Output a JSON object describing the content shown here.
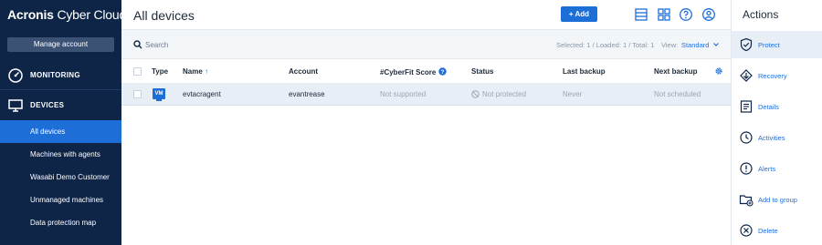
{
  "app": {
    "brand": "Acronis",
    "product": "Cyber Cloud",
    "accent_color": "#1e6ed8",
    "sidebar_color": "#0e2547"
  },
  "sidebar": {
    "manage_account_label": "Manage account",
    "monitoring_label": "MONITORING",
    "devices_label": "DEVICES",
    "sub_items": [
      {
        "label": "All devices",
        "active": true
      },
      {
        "label": "Machines with agents",
        "active": false
      },
      {
        "label": "Wasabi Demo Customer",
        "active": false
      },
      {
        "label": "Unmanaged machines",
        "active": false
      },
      {
        "label": "Data protection map",
        "active": false
      }
    ]
  },
  "header": {
    "title": "All devices",
    "add_label": "+ Add",
    "icons": [
      "columns-icon",
      "grid-icon",
      "help-icon",
      "user-icon"
    ]
  },
  "toolbar": {
    "search_placeholder": "Search",
    "counts_text": "Selected: 1 / Loaded: 1 / Total: 1",
    "view_label": "View:",
    "view_value": "Standard"
  },
  "table": {
    "columns": {
      "type": "Type",
      "name": "Name",
      "account": "Account",
      "cyberfit": "#CyberFit Score",
      "status": "Status",
      "last_backup": "Last backup",
      "next_backup": "Next backup"
    },
    "rows": [
      {
        "type_badge": "VM",
        "name": "evtacragent",
        "account": "evantrease",
        "cyberfit": "Not supported",
        "status": "Not protected",
        "last_backup": "Never",
        "next_backup": "Not scheduled"
      }
    ]
  },
  "actions_panel": {
    "title": "Actions",
    "items": [
      {
        "label": "Protect",
        "icon": "shield-check-icon",
        "selected": true
      },
      {
        "label": "Recovery",
        "icon": "recovery-icon",
        "selected": false
      },
      {
        "label": "Details",
        "icon": "details-icon",
        "selected": false
      },
      {
        "label": "Activities",
        "icon": "clock-icon",
        "selected": false
      },
      {
        "label": "Alerts",
        "icon": "alert-icon",
        "selected": false
      },
      {
        "label": "Add to group",
        "icon": "folder-add-icon",
        "selected": false
      },
      {
        "label": "Delete",
        "icon": "delete-icon",
        "selected": false
      }
    ]
  }
}
